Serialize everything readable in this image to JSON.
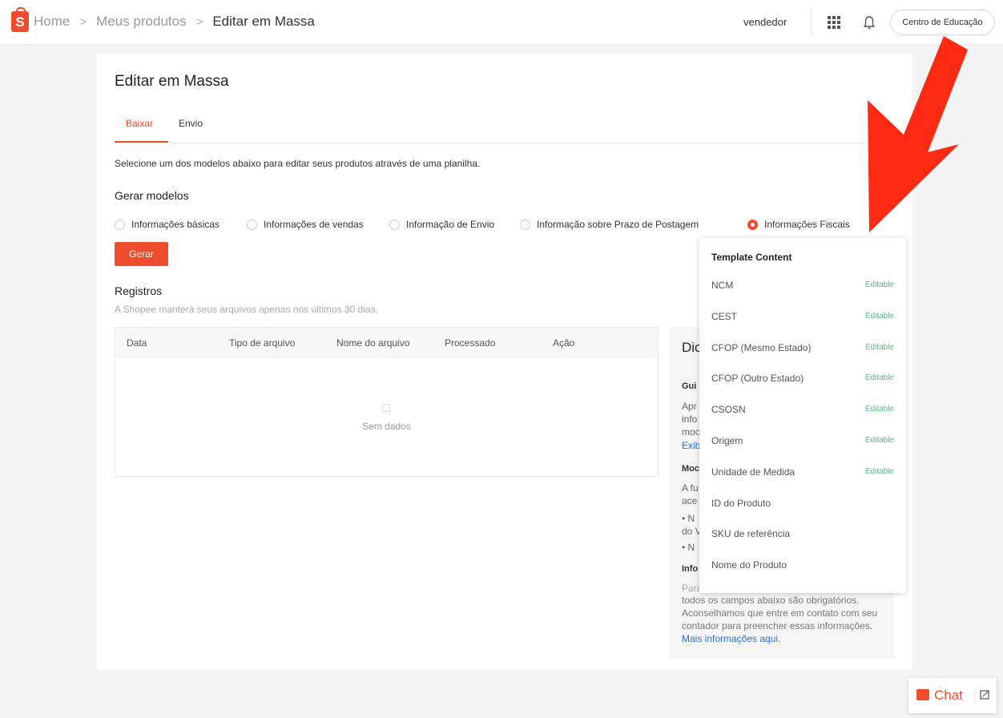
{
  "header": {
    "breadcrumbs": [
      "Home",
      "Meus produtos",
      "Editar em Massa"
    ],
    "seller": "vendedor",
    "education_button": "Centro de Educação"
  },
  "page": {
    "title": "Editar em Massa",
    "tabs": [
      {
        "label": "Baixar",
        "active": true
      },
      {
        "label": "Envio",
        "active": false
      }
    ],
    "description": "Selecione um dos modelos abaixo para editar seus produtos através de uma planilha.",
    "generate_section": "Gerar modelos",
    "templates": [
      {
        "label": "Informações básicas",
        "selected": false
      },
      {
        "label": "Informações de vendas",
        "selected": false
      },
      {
        "label": "Informação de Envio",
        "selected": false
      },
      {
        "label": "Informação sobre Prazo de Postagem",
        "selected": false
      },
      {
        "label": "Informações Fiscais",
        "selected": true
      }
    ],
    "generate_button": "Gerar",
    "records_title": "Registros",
    "records_note": "A Shopee manterá seus arquivos apenas nos últimos 30 dias.",
    "table": {
      "columns": [
        "Data",
        "Tipo de arquivo",
        "Nome do arquivo",
        "Processado",
        "Ação"
      ],
      "empty_text": "Sem dados"
    }
  },
  "side_panel": {
    "title": "Dic",
    "guide_heading": "Gui",
    "guide_text_lines": [
      "Apr",
      "info",
      "moc"
    ],
    "guide_link": "Exib",
    "models_heading": "Moc",
    "models_text_lines": [
      "A fu",
      "ace"
    ],
    "bullet_lines": [
      "• N",
      "do V",
      "• N"
    ],
    "info_heading": "Info",
    "info_text_partial": "Para",
    "info_text": "todos os campos abaixo são obrigatórios. Aconselhamos que entre em contato com seu contador para preencher essas informações.",
    "info_link": "Mais informações aqui."
  },
  "dropdown": {
    "title": "Template Content",
    "rows": [
      {
        "label": "NCM",
        "badge": "Editable"
      },
      {
        "label": "CEST",
        "badge": "Editable"
      },
      {
        "label": "CFOP (Mesmo Estado)",
        "badge": "Editable"
      },
      {
        "label": "CFOP (Outro Estado)",
        "badge": "Editable"
      },
      {
        "label": "CSOSN",
        "badge": "Editable"
      },
      {
        "label": "Origem",
        "badge": "Editable"
      },
      {
        "label": "Unidade de Medida",
        "badge": "Editable"
      },
      {
        "label": "ID do Produto",
        "badge": ""
      },
      {
        "label": "SKU de referência",
        "badge": ""
      },
      {
        "label": "Nome do Produto",
        "badge": ""
      }
    ]
  },
  "chat": {
    "label": "Chat"
  },
  "colors": {
    "brand": "#ee4d2d",
    "editable": "#4cc17f",
    "link": "#2673dd",
    "arrow": "#ff2a14"
  },
  "icons": [
    "shopee-bag-icon",
    "apps-grid-icon",
    "bell-icon",
    "chat-icon",
    "minimize-icon",
    "empty-data-icon",
    "annotation-arrow"
  ]
}
